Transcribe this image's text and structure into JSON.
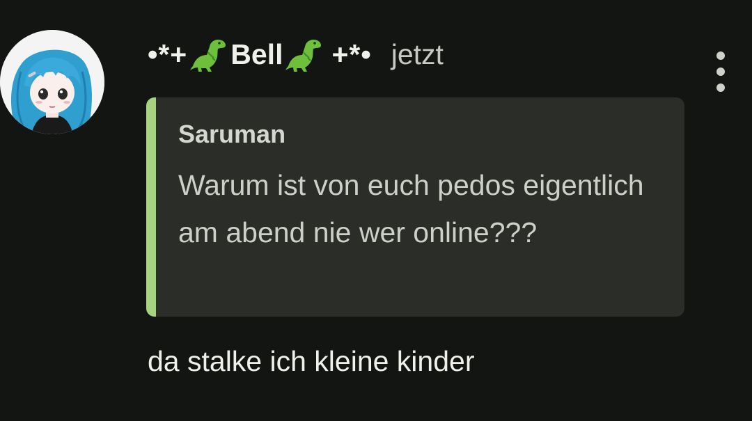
{
  "comment": {
    "author": {
      "prefix": "•*+",
      "name": "Bell",
      "suffix": "+*•",
      "emoji_icon": "dinosaur-icon",
      "avatar_icon": "anime-girl-avatar"
    },
    "timestamp": "jetzt",
    "menu_icon": "more-vertical-icon",
    "quote": {
      "author": "Saruman",
      "text": "Warum ist von euch pedos eigentlich am abend nie wer online???"
    },
    "text": "da stalke ich kleine kinder"
  },
  "colors": {
    "background": "#131512",
    "quote_background": "#2b2d29",
    "quote_accent": "#a6d37f",
    "avatar_hair": "#2f9fd0"
  }
}
